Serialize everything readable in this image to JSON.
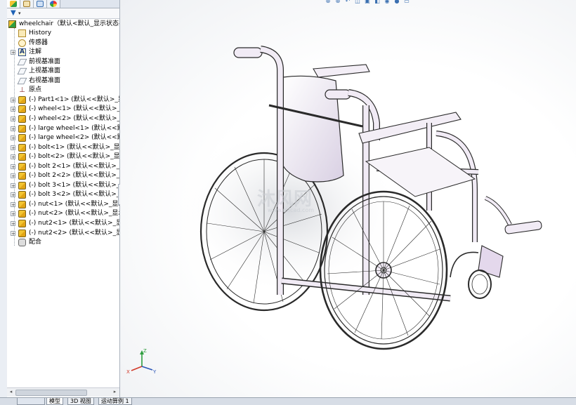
{
  "tree": {
    "root": "wheelchair（默认<默认_显示状态-",
    "items": [
      {
        "label": "History",
        "icon": "history-icon"
      },
      {
        "label": "传感器",
        "icon": "sensor-icon"
      },
      {
        "label": "注解",
        "icon": "annotation-icon"
      },
      {
        "label": "前视基准面",
        "icon": "plane-icon"
      },
      {
        "label": "上视基准面",
        "icon": "plane-icon"
      },
      {
        "label": "右视基准面",
        "icon": "plane-icon"
      },
      {
        "label": "原点",
        "icon": "origin-icon"
      },
      {
        "label": "(-) Part1<1> (默认<<默认>_显",
        "icon": "part-icon"
      },
      {
        "label": "(-) wheel<1> (默认<<默认>_显",
        "icon": "part-icon"
      },
      {
        "label": "(-) wheel<2> (默认<<默认>_显",
        "icon": "part-icon"
      },
      {
        "label": "(-) large wheel<1> (默认<<默",
        "icon": "part-icon"
      },
      {
        "label": "(-) large wheel<2> (默认<<默",
        "icon": "part-icon"
      },
      {
        "label": "(-) bolt<1> (默认<<默认>_显示",
        "icon": "part-icon"
      },
      {
        "label": "(-) bolt<2> (默认<<默认>_显示",
        "icon": "part-icon"
      },
      {
        "label": "(-) bolt 2<1> (默认<<默认>_显",
        "icon": "part-icon"
      },
      {
        "label": "(-) bolt 2<2> (默认<<默认>_显",
        "icon": "part-icon"
      },
      {
        "label": "(-) bolt 3<1> (默认<<默认>_显",
        "icon": "part-icon"
      },
      {
        "label": "(-) bolt 3<2> (默认<<默认>_显",
        "icon": "part-icon"
      },
      {
        "label": "(-) nut<1> (默认<<默认>_显示",
        "icon": "part-icon"
      },
      {
        "label": "(-) nut<2> (默认<<默认>_显示",
        "icon": "part-icon"
      },
      {
        "label": "(-) nut2<1> (默认<<默认>_显示",
        "icon": "part-icon"
      },
      {
        "label": "(-) nut2<2> (默认<<默认>_显示",
        "icon": "part-icon"
      },
      {
        "label": "配合",
        "icon": "mates-icon"
      }
    ]
  },
  "triad": {
    "x": "X",
    "y": "Y",
    "z": "Z"
  },
  "watermark": {
    "text": "沐风网",
    "subtext": "www.mfcad.com"
  },
  "bottom_tabs": [
    "模型",
    "3D 视图",
    "运动算例 1"
  ],
  "colors": {
    "frame": "#e4d8ec",
    "frame_stroke": "#2a2a2a",
    "accent": "#1e62b6"
  }
}
